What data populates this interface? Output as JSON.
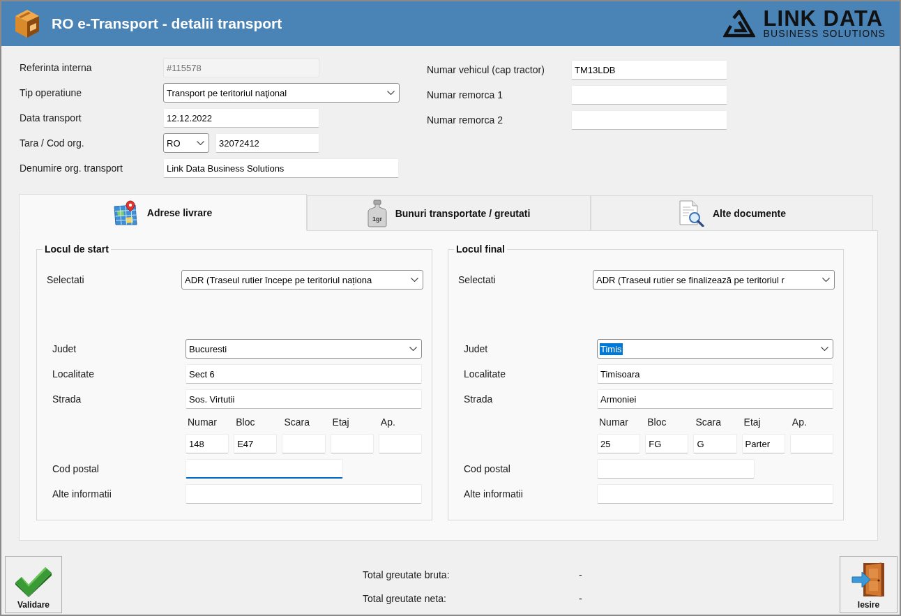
{
  "window": {
    "title": "RO e-Transport - detalii transport"
  },
  "logo": {
    "name": "LINK DATA",
    "tagline": "BUSINESS SOLUTIONS"
  },
  "transport": [
    {
      "kind": "text",
      "label": "Referinta interna",
      "value": "#115578",
      "disabled": true
    },
    {
      "kind": "select",
      "label": "Tip operatiune",
      "value": "Transport pe teritoriul naţional",
      "disabled": false
    },
    {
      "kind": "text",
      "label": "Data transport",
      "value": "12.12.2022",
      "disabled": false
    },
    {
      "kind": "country",
      "label": "Tara / Cod org.",
      "country": "RO",
      "value": "32072412",
      "disabled": false
    },
    {
      "kind": "wide_text",
      "label": "Denumire org. transport",
      "value": "Link Data Business Solutions",
      "disabled": false
    }
  ],
  "vehicle": [
    {
      "label": "Numar vehicul (cap tractor)",
      "value": "TM13LDB"
    },
    {
      "label": "Numar remorca 1"
    },
    {
      "label": "Numar remorca 2"
    }
  ],
  "tabs": [
    {
      "kind": "map",
      "label": "Adrese livrare",
      "selected": true
    },
    {
      "kind": "weight",
      "label": "Bunuri transportate / greutati",
      "icon_text": "1gr",
      "selected": false
    },
    {
      "kind": "document",
      "label": "Alte documente",
      "selected": false
    }
  ],
  "locations": [
    {
      "title": "Locul de start",
      "selector": {
        "label": "Selectati",
        "value": "ADR (Traseul rutier începe pe teritoriul naționa"
      },
      "fields": [
        {
          "kind": "select",
          "label": "Judet",
          "value": "Bucuresti",
          "highlighted": false,
          "focused": false
        },
        {
          "kind": "text",
          "label": "Localitate",
          "value": "Sect 6",
          "focused": false
        },
        {
          "kind": "text",
          "label": "Strada",
          "value": "Sos. Virtutii",
          "focused": false
        },
        {
          "kind": "parts",
          "parts": [
            {
              "label": "Numar",
              "value": "148"
            },
            {
              "label": "Bloc",
              "value": "E47"
            },
            {
              "label": "Scara"
            },
            {
              "label": "Etaj"
            },
            {
              "label": "Ap."
            }
          ]
        },
        {
          "kind": "short",
          "label": "Cod postal",
          "focused": true
        },
        {
          "kind": "text",
          "label": "Alte informatii",
          "focused": false
        }
      ]
    },
    {
      "title": "Locul final",
      "selector": {
        "label": "Selectati",
        "value": "ADR (Traseul rutier se finalizează pe teritoriul r"
      },
      "fields": [
        {
          "kind": "select",
          "label": "Judet",
          "value": "Timis",
          "highlighted": true,
          "focused": false
        },
        {
          "kind": "text",
          "label": "Localitate",
          "value": "Timisoara",
          "focused": false
        },
        {
          "kind": "text",
          "label": "Strada",
          "value": "Armoniei",
          "focused": false
        },
        {
          "kind": "parts",
          "parts": [
            {
              "label": "Numar",
              "value": "25"
            },
            {
              "label": "Bloc",
              "value": "FG"
            },
            {
              "label": "Scara",
              "value": "G"
            },
            {
              "label": "Etaj",
              "value": "Parter"
            },
            {
              "label": "Ap."
            }
          ]
        },
        {
          "kind": "short",
          "label": "Cod postal",
          "focused": false
        },
        {
          "kind": "text",
          "label": "Alte informatii",
          "focused": false
        }
      ]
    }
  ],
  "totals": [
    {
      "label": "Total greutate bruta:",
      "value": "-"
    },
    {
      "label": "Total greutate neta:",
      "value": "-"
    }
  ],
  "buttons": [
    {
      "kind": "validate",
      "label": "Validare"
    },
    {
      "kind": "exit",
      "label": "Iesire"
    }
  ]
}
